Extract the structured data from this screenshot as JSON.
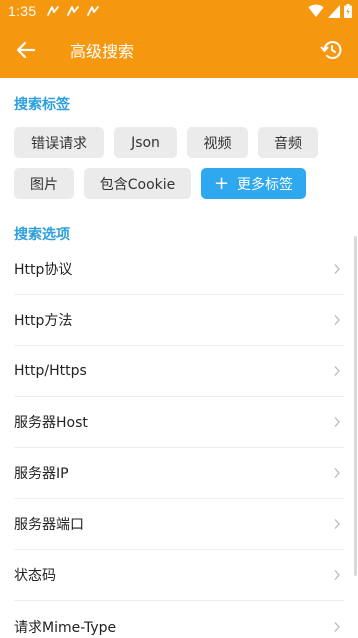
{
  "status_bar": {
    "time": "1:35",
    "notification_icons": [
      "notif-icon",
      "notif-icon",
      "notif-icon"
    ],
    "right_icons": [
      "wifi-icon",
      "signal-icon",
      "battery-icon"
    ]
  },
  "app_bar": {
    "title": "高级搜索",
    "back_icon": "arrow-left-icon",
    "history_icon": "history-icon"
  },
  "tags_section": {
    "title": "搜索标签",
    "chips": [
      {
        "label": "错误请求"
      },
      {
        "label": "Json"
      },
      {
        "label": "视频"
      },
      {
        "label": "音频"
      },
      {
        "label": "图片"
      },
      {
        "label": "包含Cookie"
      }
    ],
    "more_button": {
      "plus": "+",
      "label": "更多标签"
    }
  },
  "options_section": {
    "title": "搜索选项",
    "items": [
      {
        "label": "Http协议"
      },
      {
        "label": "Http方法"
      },
      {
        "label": "Http/Https"
      },
      {
        "label": "服务器Host"
      },
      {
        "label": "服务器IP"
      },
      {
        "label": "服务器端口"
      },
      {
        "label": "状态码"
      },
      {
        "label": "请求Mime-Type"
      }
    ]
  },
  "colors": {
    "accent": "#f6980f",
    "section_title": "#2d9fdc",
    "primary_button": "#2ea8ef",
    "chip_bg": "#ebebeb"
  }
}
